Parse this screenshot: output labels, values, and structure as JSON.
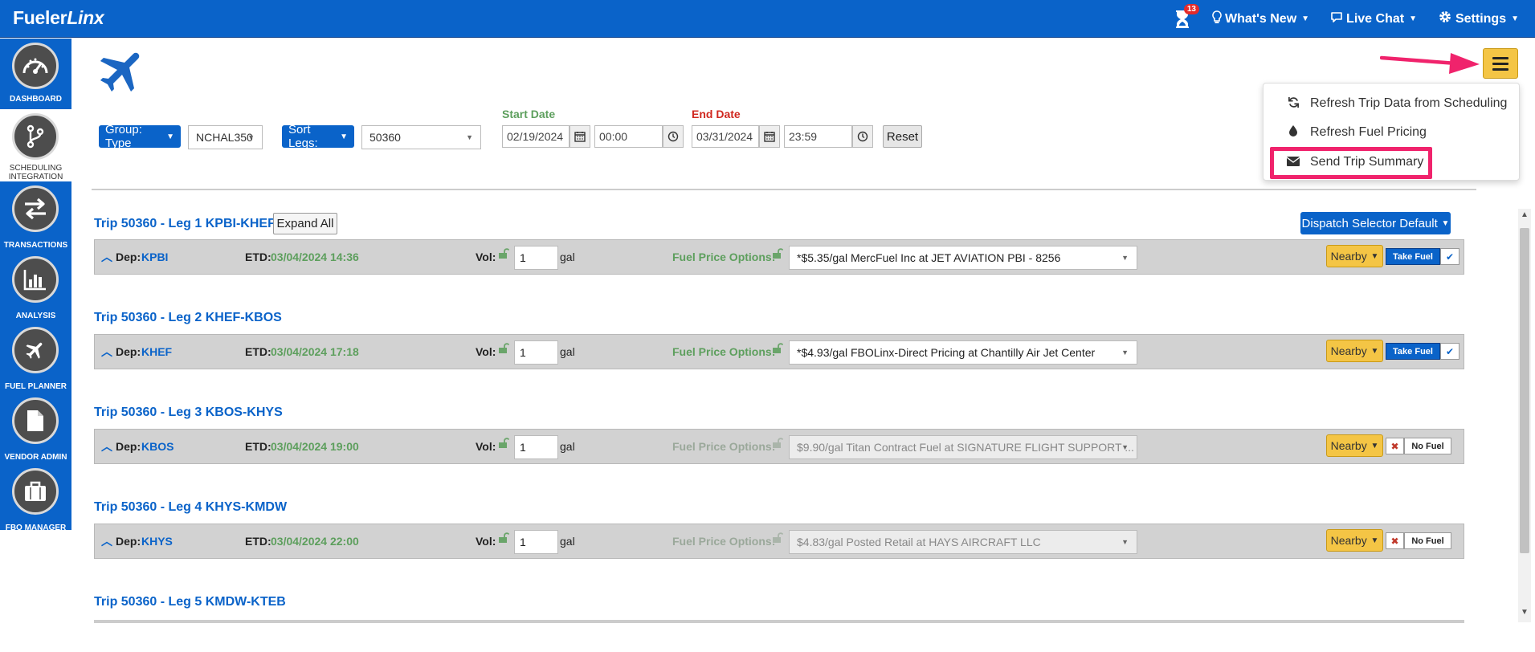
{
  "app": {
    "logo_main": "Fueler",
    "logo_italic": "Linx"
  },
  "topnav": {
    "notification_count": "13",
    "whats_new": "What's New",
    "live_chat": "Live Chat",
    "settings": "Settings"
  },
  "sidebar": {
    "items": [
      {
        "label": "DASHBOARD",
        "icon": "speedometer-icon"
      },
      {
        "label": "SCHEDULING INTEGRATION",
        "icon": "branch-icon"
      },
      {
        "label": "TRANSACTIONS",
        "icon": "exchange-arrows-icon"
      },
      {
        "label": "ANALYSIS",
        "icon": "bar-chart-icon"
      },
      {
        "label": "FUEL PLANNER",
        "icon": "airplane-icon"
      },
      {
        "label": "VENDOR ADMIN",
        "icon": "document-icon"
      },
      {
        "label": "FBO MANAGER",
        "icon": "briefcase-icon"
      }
    ]
  },
  "menu": {
    "refresh_trip": "Refresh Trip Data from Scheduling",
    "refresh_fuel": "Refresh Fuel Pricing",
    "send_summary": "Send Trip Summary"
  },
  "filters": {
    "group_type": "Group: Type",
    "tail": "NCHAL350",
    "sort_legs": "Sort Legs:",
    "trip": "50360",
    "start_label": "Start Date",
    "start_date": "02/19/2024",
    "start_time": "00:00",
    "end_label": "End Date",
    "end_date": "03/31/2024",
    "end_time": "23:59",
    "reset": "Reset"
  },
  "expand_all": "Expand All",
  "dispatch_selector": "Dispatch Selector Default",
  "labels": {
    "dep": "Dep:",
    "etd": "ETD:",
    "vol": "Vol:",
    "gal": "gal",
    "fuel_price_options": "Fuel Price Options:",
    "nearby": "Nearby",
    "take_fuel": "Take Fuel",
    "no_fuel": "No Fuel"
  },
  "legs": [
    {
      "title": "Trip 50360 - Leg 1 KPBI-KHEF",
      "dep": "KPBI",
      "etd": "03/04/2024 14:36",
      "vol": "1",
      "fuel_option": "*$5.35/gal MercFuel Inc at JET AVIATION PBI - 8256",
      "status": "take"
    },
    {
      "title": "Trip 50360 - Leg 2 KHEF-KBOS",
      "dep": "KHEF",
      "etd": "03/04/2024 17:18",
      "vol": "1",
      "fuel_option": "*$4.93/gal FBOLinx-Direct Pricing at Chantilly Air Jet Center",
      "status": "take"
    },
    {
      "title": "Trip 50360 - Leg 3 KBOS-KHYS",
      "dep": "KBOS",
      "etd": "03/04/2024 19:00",
      "vol": "1",
      "fuel_option": "$9.90/gal Titan Contract Fuel at SIGNATURE FLIGHT SUPPORT ...",
      "status": "none"
    },
    {
      "title": "Trip 50360 - Leg 4 KHYS-KMDW",
      "dep": "KHYS",
      "etd": "03/04/2024 22:00",
      "vol": "1",
      "fuel_option": "$4.83/gal Posted Retail at HAYS AIRCRAFT LLC",
      "status": "none"
    },
    {
      "title": "Trip 50360 - Leg 5 KMDW-KTEB"
    }
  ],
  "colors": {
    "brand_blue": "#0a63c9",
    "accent_yellow": "#f4c545",
    "highlight_pink": "#f0236c",
    "date_green": "#5d9f5d",
    "end_date_red": "#d0281f"
  }
}
